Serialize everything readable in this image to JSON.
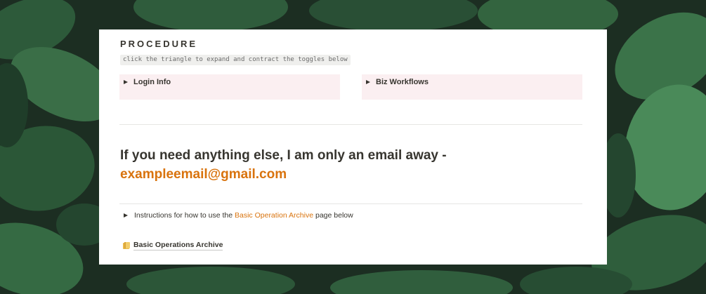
{
  "theme": {
    "accent": "#d9730d",
    "toggle_bg": "#fbeff1",
    "text": "#37352f",
    "background_foliage": "#24402e"
  },
  "page": {
    "heading": "PROCEDURE",
    "hint_code": "click the triangle to expand and contract the toggles below",
    "toggles": [
      {
        "label": "Login Info",
        "icon": "triangle-right-icon"
      },
      {
        "label": "Biz Workflows",
        "icon": "triangle-right-icon"
      }
    ],
    "contact_text": "If you need anything else, I am only an email away -",
    "email": "exampleemail@gmail.com",
    "instructions": {
      "prefix": "Instructions for how to use the",
      "link": "Basic Operation Archive",
      "suffix": "page below",
      "icon": "triangle-right-icon"
    },
    "archive_page": {
      "label": "Basic Operations Archive",
      "icon": "folder-icon"
    }
  }
}
